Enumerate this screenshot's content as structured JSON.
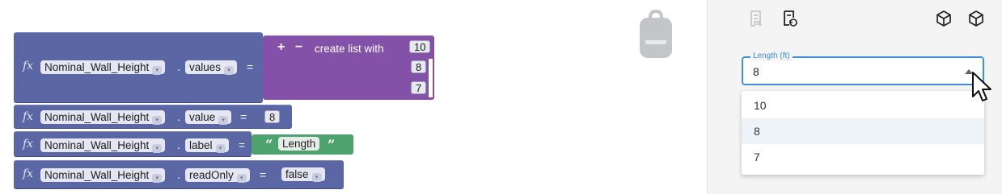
{
  "workspace": {
    "blocks": [
      {
        "fx": "fx",
        "variable": "Nominal_Wall_Height",
        "dot": ".",
        "property": "values",
        "equals": "=",
        "list": {
          "title": "create list with",
          "plus": "+",
          "minus": "−",
          "items": [
            "10",
            "8",
            "7"
          ]
        }
      },
      {
        "fx": "fx",
        "variable": "Nominal_Wall_Height",
        "dot": ".",
        "property": "value",
        "equals": "=",
        "number": "8"
      },
      {
        "fx": "fx",
        "variable": "Nominal_Wall_Height",
        "dot": ".",
        "property": "label",
        "equals": "=",
        "string": {
          "open_quote": "“",
          "text": "Length",
          "close_quote": "”"
        }
      },
      {
        "fx": "fx",
        "variable": "Nominal_Wall_Height",
        "dot": ".",
        "property": "readOnly",
        "equals": "=",
        "boolean": "false"
      }
    ],
    "dropdown_arrow": "▾"
  },
  "panel": {
    "field": {
      "label": "Length (ft)",
      "value": "8"
    },
    "options": [
      "10",
      "8",
      "7"
    ],
    "selected_option": "8"
  },
  "colors": {
    "variable_block": "#5b67a5",
    "list_block": "#8451a8",
    "text_block": "#4ca36e",
    "accent": "#3e8fd7"
  },
  "icons": [
    "fx-icon",
    "backpack-icon",
    "script-icon",
    "script-refresh-icon",
    "cube-icon",
    "cube-outline-icon",
    "mouse-cursor-icon"
  ]
}
